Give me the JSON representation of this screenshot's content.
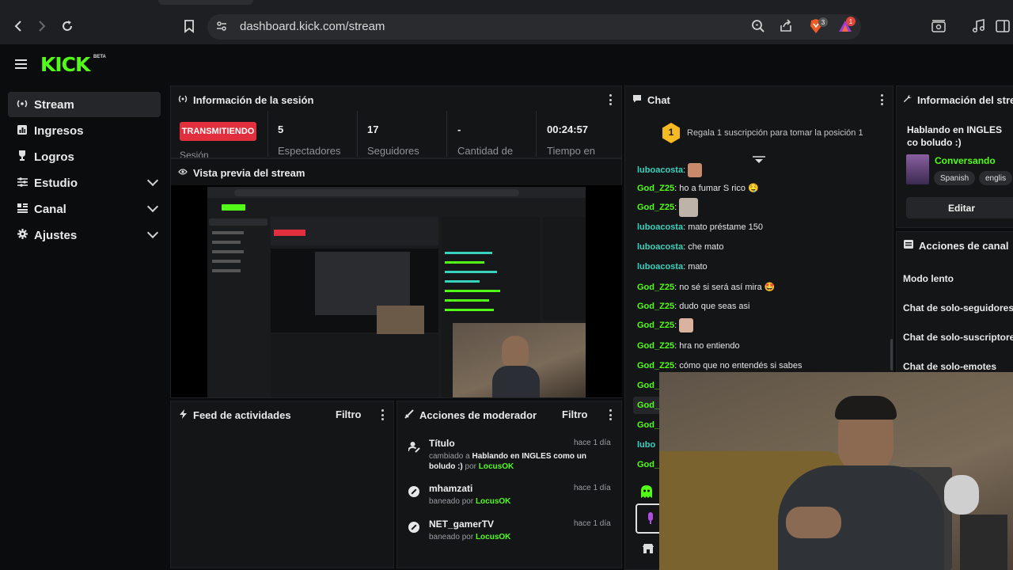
{
  "browser": {
    "url": "dashboard.kick.com/stream",
    "ext_badge_1": "3",
    "ext_badge_2": "1"
  },
  "app": {
    "logo": "KICK",
    "logo_tag": "BETA"
  },
  "sidebar": {
    "items": [
      {
        "label": "Stream",
        "icon": "broadcast-icon"
      },
      {
        "label": "Ingresos",
        "icon": "chart-icon"
      },
      {
        "label": "Logros",
        "icon": "trophy-icon"
      },
      {
        "label": "Estudio",
        "icon": "sliders-icon"
      },
      {
        "label": "Canal",
        "icon": "layout-icon"
      },
      {
        "label": "Ajustes",
        "icon": "gear-icon"
      }
    ]
  },
  "session": {
    "title": "Información de la sesión",
    "status": "TRANSMITIENDO",
    "status_sub": "Sesión",
    "stats": [
      {
        "value": "5",
        "label": "Espectadores"
      },
      {
        "value": "17",
        "label": "Seguidores"
      },
      {
        "value": "-",
        "label": "Cantidad de"
      },
      {
        "value": "00:24:57",
        "label": "Tiempo en"
      }
    ]
  },
  "preview": {
    "title": "Vista previa del stream"
  },
  "feed": {
    "title": "Feed de actividades",
    "filter": "Filtro"
  },
  "modactions": {
    "title": "Acciones de moderador",
    "filter": "Filtro",
    "rows": [
      {
        "title": "Título",
        "prefix": "cambiado a ",
        "bold": "Hablando en INGLES como un boludo :)",
        "by": " por ",
        "user": "LocusOK",
        "time": "hace 1 día"
      },
      {
        "title": "mhamzati",
        "prefix": "baneado por ",
        "user": "LocusOK",
        "time": "hace 1 día"
      },
      {
        "title": "NET_gamerTV",
        "prefix": "baneado por ",
        "user": "LocusOK",
        "time": "hace 1 día"
      }
    ]
  },
  "chat": {
    "title": "Chat",
    "gift_rank": "1",
    "gift_text": "Regala 1 suscripción para tomar la posición 1",
    "messages": [
      {
        "user": "luboacosta",
        "text": ""
      },
      {
        "user": "God_Z25",
        "text": "ho a fumar S rico 🤤"
      },
      {
        "user": "God_Z25",
        "text": ""
      },
      {
        "user": "luboacosta",
        "text": "mato préstame 150"
      },
      {
        "user": "luboacosta",
        "text": "che mato"
      },
      {
        "user": "luboacosta",
        "text": "mato"
      },
      {
        "user": "God_Z25",
        "text": "no sé si será así mira 🤩"
      },
      {
        "user": "God_Z25",
        "text": "dudo que seas asi"
      },
      {
        "user": "God_Z25",
        "text": ""
      },
      {
        "user": "God_Z25",
        "text": "hra no entiendo"
      },
      {
        "user": "God_Z25",
        "text": "cómo que no entendés si sabes"
      },
      {
        "user": "God_Z",
        "text": ""
      },
      {
        "user": "God_Z",
        "text": ""
      },
      {
        "user": "God_Z",
        "text": ""
      },
      {
        "user": "lubo",
        "text": ""
      },
      {
        "user": "God_Z",
        "text": ""
      }
    ]
  },
  "stream_info": {
    "title": "Información del strea",
    "stream_title": "Hablando en INGLES co boludo :)",
    "category": "Conversando",
    "tags": [
      "Spanish",
      "englis"
    ],
    "edit": "Editar"
  },
  "channel_actions": {
    "title": "Acciones de canal",
    "items": [
      "Modo lento",
      "Chat de solo-seguidores",
      "Chat de solo-suscriptore",
      "Chat de solo-emotes"
    ]
  },
  "colors": {
    "brand": "#53fc18",
    "live": "#e12f3e",
    "teal_user": "#38d1bd",
    "gift_gold": "#f5b921"
  }
}
